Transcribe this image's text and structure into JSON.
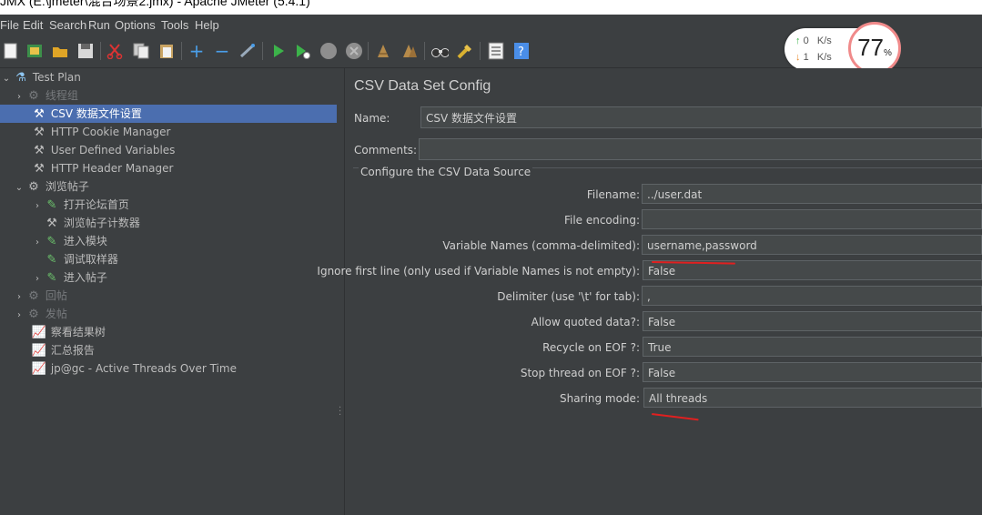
{
  "window": {
    "title": "JMX (E:\\jmeter\\混合场景2.jmx) - Apache JMeter (5.4.1)"
  },
  "menu": {
    "file": "File",
    "edit": "Edit",
    "search": "Search",
    "run": "Run",
    "options": "Options",
    "tools": "Tools",
    "help": "Help"
  },
  "toolbar_icons": [
    "new-icon",
    "templates-icon",
    "open-icon",
    "save-icon",
    "cut-icon",
    "copy-icon",
    "paste-icon",
    "expand-icon",
    "collapse-icon",
    "toggle-icon",
    "start-icon",
    "start-no-pause-icon",
    "stop-icon",
    "shutdown-icon",
    "clear-icon",
    "clear-all-icon",
    "search-icon",
    "reset-search-icon",
    "function-helper-icon",
    "help-icon"
  ],
  "speed": {
    "up": "0",
    "down": "1",
    "unit": "K/s",
    "percent": "77",
    "percent_sign": "%"
  },
  "tree": [
    {
      "label": "Test Plan",
      "icon": "flask-icon"
    },
    {
      "label": "线程组",
      "icon": "gear-icon"
    },
    {
      "label": "CSV 数据文件设置",
      "icon": "tools-icon"
    },
    {
      "label": "HTTP Cookie Manager",
      "icon": "tools-icon"
    },
    {
      "label": "User Defined Variables",
      "icon": "tools-icon"
    },
    {
      "label": "HTTP Header Manager",
      "icon": "tools-icon"
    },
    {
      "label": "浏览帖子",
      "icon": "gear-icon"
    },
    {
      "label": "打开论坛首页",
      "icon": "pipette-icon"
    },
    {
      "label": "浏览帖子计数器",
      "icon": "tools-icon"
    },
    {
      "label": "进入模块",
      "icon": "pipette-icon"
    },
    {
      "label": "调试取样器",
      "icon": "pipette-icon"
    },
    {
      "label": "进入帖子",
      "icon": "pipette-icon"
    },
    {
      "label": "回帖",
      "icon": "gear-icon"
    },
    {
      "label": "发帖",
      "icon": "gear-icon"
    },
    {
      "label": "察看结果树",
      "icon": "chart-icon"
    },
    {
      "label": "汇总报告",
      "icon": "chart-icon"
    },
    {
      "label": "jp@gc - Active Threads Over Time",
      "icon": "chart-icon"
    }
  ],
  "panel": {
    "title": "CSV Data Set Config",
    "name_label": "Name:",
    "name_value": "CSV 数据文件设置",
    "comments_label": "Comments:",
    "comments_value": "",
    "section_title": "Configure the CSV Data Source",
    "fields": [
      {
        "label": "Filename:",
        "value": "../user.dat"
      },
      {
        "label": "File encoding:",
        "value": ""
      },
      {
        "label": "Variable Names (comma-delimited):",
        "value": "username,password"
      },
      {
        "label": "Ignore first line (only used if Variable Names is not empty):",
        "value": "False"
      },
      {
        "label": "Delimiter (use '\\t' for tab):",
        "value": ","
      },
      {
        "label": "Allow quoted data?:",
        "value": "False"
      },
      {
        "label": "Recycle on EOF ?:",
        "value": "True"
      },
      {
        "label": "Stop thread on EOF ?:",
        "value": "False"
      },
      {
        "label": "Sharing mode:",
        "value": "All threads"
      }
    ]
  },
  "colors": {
    "background": "#3c3f41",
    "selection": "#4b6eaf",
    "annotation": "#e02020"
  }
}
